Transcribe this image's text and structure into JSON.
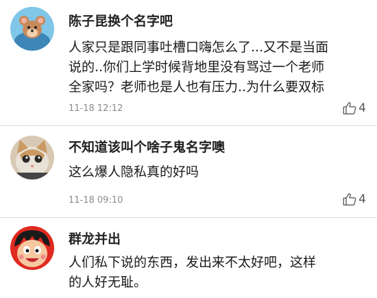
{
  "comments": [
    {
      "username": "陈子昆换个名字吧",
      "lines": [
        "人家只是跟同事吐槽口嗨怎么了...又不是当面",
        "说的..你们上学时候背地里没有骂过一个老师",
        "全家吗？老师也是人也有压力..为什么要双标"
      ],
      "time": "11-18 12:12",
      "likes": "4"
    },
    {
      "username": "不知道该叫个啥子鬼名字噢",
      "lines": [
        "这么爆人隐私真的好吗"
      ],
      "time": "11-18 09:10",
      "likes": "4"
    },
    {
      "username": "群龙并出",
      "lines": [
        "人们私下说的东西，发出来不太好吧，这样",
        "的人好无耻。"
      ]
    }
  ],
  "icons": {
    "like": "thumbs-up-icon"
  },
  "colors": {
    "divider": "#dedede",
    "meta": "#8a8a8a"
  }
}
